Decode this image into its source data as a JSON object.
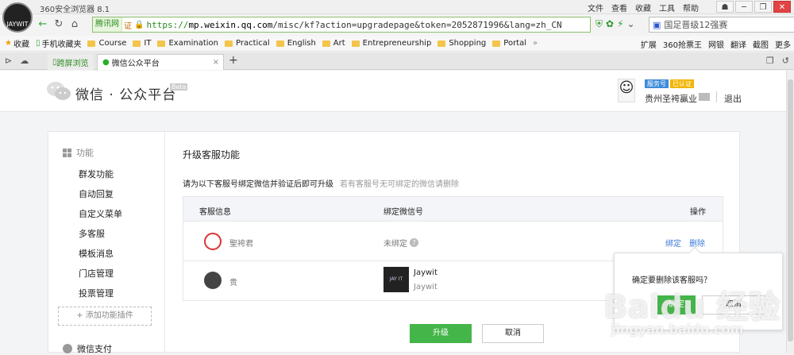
{
  "window": {
    "app_title": "360安全浏览器 8.1",
    "logo_text": "JAYWIT",
    "menu": [
      "文件",
      "查看",
      "收藏",
      "工具",
      "帮助"
    ],
    "controls": [
      "☗",
      "─",
      "❐",
      "✕"
    ]
  },
  "navbar": {
    "site_badge": "腾讯网",
    "cert": "证",
    "url_prefix": "https://",
    "url_domain": "mp.weixin.qq.com",
    "url_path": "/misc/kf?action=upgradepage&token=2052871996&lang=zh_CN",
    "search_text": "国足晋级12强赛"
  },
  "bookmarks": {
    "left": [
      "收藏",
      "手机收藏夹",
      "Course",
      "IT",
      "Examination",
      "Practical",
      "English",
      "Art",
      "Entrepreneurship",
      "Shopping",
      "Portal"
    ],
    "more": "»",
    "right": [
      "扩展",
      "360抢票王",
      "网银",
      "翻译",
      "截图",
      "更多"
    ]
  },
  "tabs": {
    "tab1": "跨屏浏览",
    "tab2": "微信公众平台",
    "new_tab": "+"
  },
  "header": {
    "brand": "微信 · 公众平台",
    "beta": "Beta",
    "badge_service": "服务号",
    "badge_verified": "已认证",
    "account": "贵州圣袴贏业",
    "logout": "退出"
  },
  "sidebar": {
    "title": "功能",
    "items": [
      "群发功能",
      "自动回复",
      "自定义菜单",
      "多客服",
      "模板消息",
      "门店管理",
      "投票管理"
    ],
    "add_plugin": "添加功能插件",
    "pay": "微信支付"
  },
  "content": {
    "title": "升级客服功能",
    "desc": "请为以下客服号绑定微信并验证后即可升级",
    "hint": "若有客服号无可绑定的微信请删除",
    "headers": {
      "info": "客服信息",
      "wechat": "绑定微信号",
      "op": "操作"
    },
    "rows": [
      {
        "name": "聖袴君",
        "status": "未绑定",
        "bind": "绑定",
        "delete": "删除"
      },
      {
        "name": "贵",
        "wechat_name": "Jaywit",
        "wechat_id": "Jaywit"
      }
    ],
    "upgrade": "升级",
    "cancel": "取消"
  },
  "popover": {
    "text": "确定要删除该客服吗？",
    "ok": "确定",
    "cancel": "取消"
  },
  "watermark": {
    "main": "Baidu 经验",
    "sub": "jingyan.baidu.com"
  }
}
